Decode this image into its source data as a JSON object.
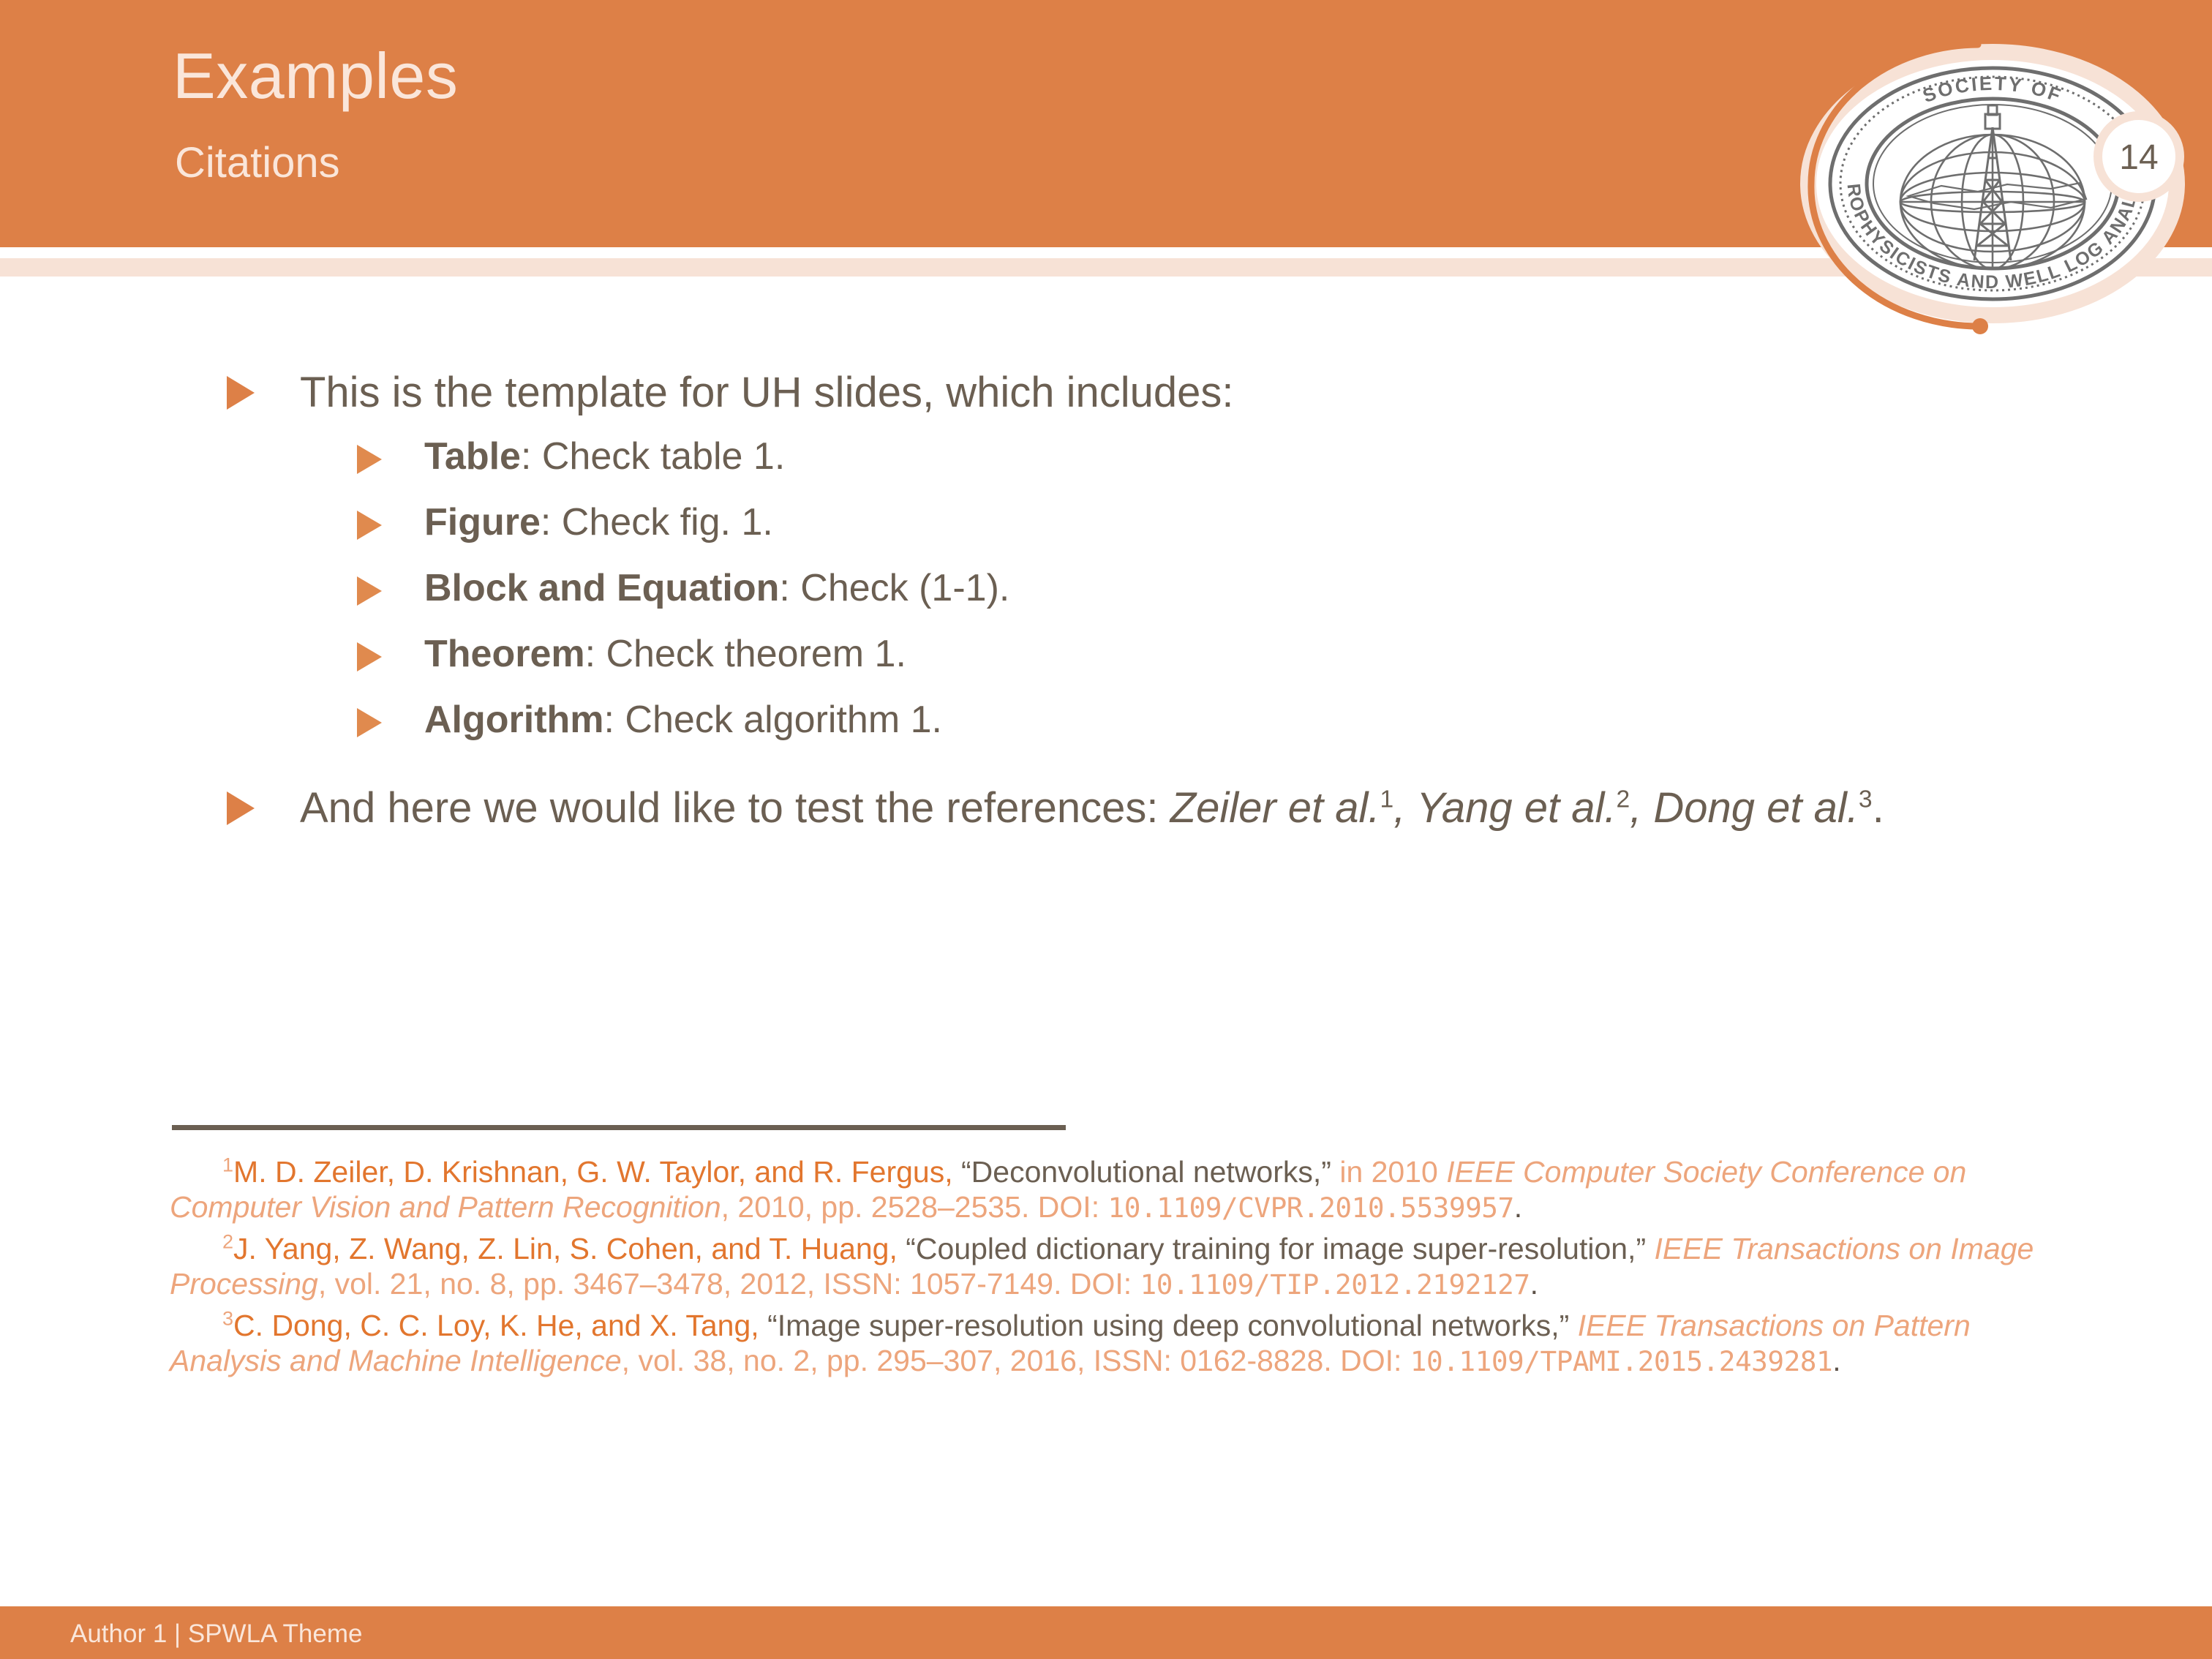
{
  "header": {
    "title": "Examples",
    "subtitle": "Citations",
    "page_number": "14",
    "band_color": "#dd8047",
    "accent_color": "#f7e2d6",
    "title_color": "#fae6da"
  },
  "logo": {
    "name": "spwla-seal",
    "outer_text_top": "SOCIETY OF",
    "outer_text_bottom": "PETROPHYSICISTS AND WELL LOG ANALYSTS",
    "seal_color": "#6e6e6e",
    "ring_color": "#f7e2d6",
    "swoosh_color": "#dd8047"
  },
  "body": {
    "bullet1": {
      "text": "This is the template for UH slides, which includes:",
      "sub_items": [
        {
          "label": "Table",
          "rest": ": Check table 1."
        },
        {
          "label": "Figure",
          "rest": ": Check fig. 1."
        },
        {
          "label": "Block and Equation",
          "rest": ": Check (1-1)."
        },
        {
          "label": "Theorem",
          "rest": ": Check theorem 1."
        },
        {
          "label": "Algorithm",
          "rest": ": Check algorithm 1."
        }
      ]
    },
    "bullet2": {
      "lead": "And here we would like to test the references: ",
      "cite1": "Zeiler et al.",
      "sup1": "1",
      "sep1": ", ",
      "cite2": "Yang et al.",
      "sup2": "2",
      "sep2": ", ",
      "cite3": "Dong et al.",
      "sup3": "3",
      "end": "."
    }
  },
  "footnotes": [
    {
      "num": "1",
      "authors": "M. D. Zeiler, D. Krishnan, G. W. Taylor, and R. Fergus,",
      "title": " “Deconvolutional networks,”",
      "venue_pre": " in 2010 ",
      "venue_italic": "IEEE Computer Society Conference on Computer Vision and Pattern Recognition",
      "details": ", 2010, pp. 2528–2535. DOI: ",
      "doi": "10.1109/CVPR.2010.5539957",
      "period": "."
    },
    {
      "num": "2",
      "authors": "J. Yang, Z. Wang, Z. Lin, S. Cohen, and T. Huang,",
      "title": " “Coupled dictionary training for image super-resolution,”",
      "venue_pre": " ",
      "venue_italic": "IEEE Transactions on Image Processing",
      "details": ", vol. 21, no. 8, pp. 3467–3478, 2012, ISSN: 1057-7149. DOI: ",
      "doi": "10.1109/TIP.2012.2192127",
      "period": "."
    },
    {
      "num": "3",
      "authors": "C. Dong, C. C. Loy, K. He, and X. Tang,",
      "title": " “Image super-resolution using deep convolutional networks,”",
      "venue_pre": " ",
      "venue_italic": "IEEE Transactions on Pattern Analysis and Machine Intelligence",
      "details": ", vol. 38, no. 2, pp. 295–307, 2016, ISSN: 0162-8828. DOI: ",
      "doi": "10.1109/TPAMI.2015.2439281",
      "period": "."
    }
  ],
  "footer": {
    "text": "Author 1 | SPWLA Theme"
  }
}
